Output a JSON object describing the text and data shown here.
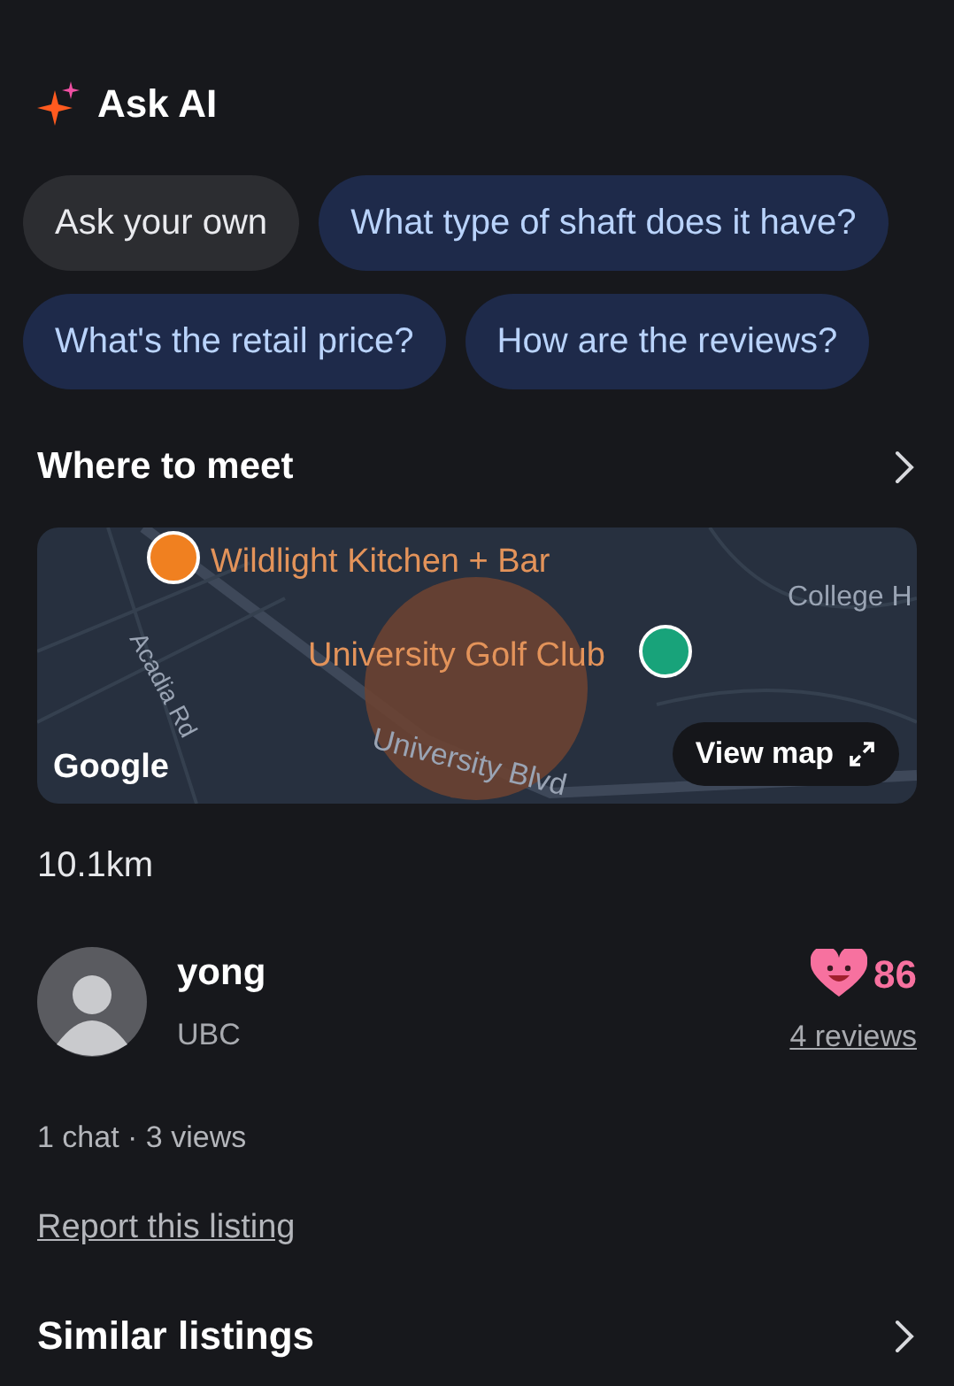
{
  "ask_ai": {
    "title": "Ask AI",
    "chip_rows": [
      [
        {
          "label": "Ask your own",
          "kind": "own"
        },
        {
          "label": "What type of shaft does it have?",
          "kind": "suggestion"
        }
      ],
      [
        {
          "label": "What's the retail price?",
          "kind": "suggestion"
        },
        {
          "label": "How are the reviews?",
          "kind": "suggestion"
        }
      ]
    ]
  },
  "meeting": {
    "title": "Where to meet",
    "map": {
      "places": [
        "Wildlight Kitchen + Bar",
        "University Golf Club"
      ],
      "roads": [
        "Acadia Rd",
        "University Blvd"
      ],
      "area": "College H",
      "attribution": "Google",
      "button": "View map"
    },
    "distance": "10.1km"
  },
  "seller": {
    "name": "yong",
    "location": "UBC",
    "score": "86",
    "reviews": "4 reviews"
  },
  "stats": "1 chat · 3 views",
  "report": "Report this listing",
  "similar": {
    "title": "Similar listings"
  }
}
